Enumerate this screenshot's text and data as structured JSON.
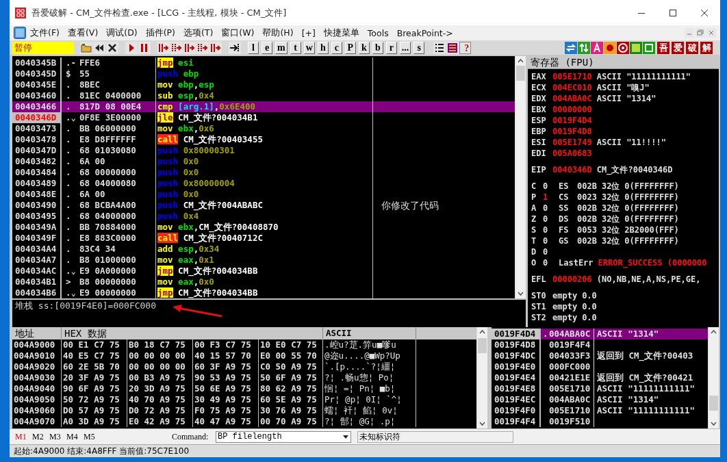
{
  "window": {
    "title": "吾爱破解 - CM_文件检查.exe - [LCG - 主线程, 模块 - CM_文件]"
  },
  "menu": [
    "文件(F)",
    "查看(V)",
    "调试(D)",
    "插件(P)",
    "选项(T)",
    "窗口(W)",
    "帮助(H)",
    "[+]",
    "快捷菜单",
    "Tools",
    "BreakPoint->"
  ],
  "toolbar": {
    "status": "暂停",
    "letter_buttons": [
      "l",
      "e",
      "m",
      "t",
      "w",
      "h",
      "c",
      "P",
      "k",
      "b",
      "r",
      "...",
      "s"
    ],
    "help_button": "?",
    "brand_buttons": [
      "吾",
      "爱",
      "破",
      "解"
    ]
  },
  "disassembly": {
    "rows": [
      {
        "address": "0040345B",
        "marker": ".-",
        "hex": "FFE6",
        "mnemonic": "jmp",
        "kind": "jump",
        "operands": [
          {
            "kind": "reg",
            "text": "esi"
          }
        ],
        "selected": false,
        "current": false
      },
      {
        "address": "0040345D",
        "marker": "$",
        "hex": "55",
        "mnemonic": "push",
        "kind": "push",
        "operands": [
          {
            "kind": "reg",
            "text": "ebp"
          }
        ],
        "selected": false,
        "current": false
      },
      {
        "address": "0040345E",
        "marker": ".",
        "hex": "8BEC",
        "mnemonic": "mov",
        "kind": "plain",
        "operands": [
          {
            "kind": "reg",
            "text": "ebp"
          },
          {
            "kind": "sep",
            "text": ","
          },
          {
            "kind": "reg",
            "text": "esp"
          }
        ],
        "selected": false,
        "current": false
      },
      {
        "address": "00403460",
        "marker": ".",
        "hex": "81EC 0400000",
        "mnemonic": "sub",
        "kind": "plain",
        "operands": [
          {
            "kind": "reg",
            "text": "esp"
          },
          {
            "kind": "sep",
            "text": ","
          },
          {
            "kind": "imm",
            "text": "0x4"
          }
        ],
        "selected": false,
        "current": false
      },
      {
        "address": "00403466",
        "marker": ".",
        "hex": "817D 08 00E4",
        "mnemonic": "cmp",
        "kind": "plain",
        "operands": [
          {
            "kind": "mem",
            "text": "[arg.1]"
          },
          {
            "kind": "sep",
            "text": ","
          },
          {
            "kind": "imm",
            "text": "0x6E400"
          }
        ],
        "selected": true,
        "current": false
      },
      {
        "address": "0040346D",
        "marker": ".⌄",
        "hex": "0F8E 3E00000",
        "mnemonic": "jle",
        "kind": "jump",
        "operands": [
          {
            "kind": "label",
            "text": "CM_文件?004034B1"
          }
        ],
        "selected": false,
        "current": true
      },
      {
        "address": "00403473",
        "marker": ".",
        "hex": "BB 06000000",
        "mnemonic": "mov",
        "kind": "plain",
        "operands": [
          {
            "kind": "reg",
            "text": "ebx"
          },
          {
            "kind": "sep",
            "text": ","
          },
          {
            "kind": "imm",
            "text": "0x6"
          }
        ],
        "selected": false,
        "current": false
      },
      {
        "address": "00403478",
        "marker": ".",
        "hex": "E8 D8FFFFFF",
        "mnemonic": "call",
        "kind": "call",
        "operands": [
          {
            "kind": "label",
            "text": "CM_文件?00403455"
          }
        ],
        "selected": false,
        "current": false
      },
      {
        "address": "0040347D",
        "marker": ".",
        "hex": "68 01030080",
        "mnemonic": "push",
        "kind": "push",
        "operands": [
          {
            "kind": "imm",
            "text": "0x80000301"
          }
        ],
        "selected": false,
        "current": false
      },
      {
        "address": "00403482",
        "marker": ".",
        "hex": "6A 00",
        "mnemonic": "push",
        "kind": "push",
        "operands": [
          {
            "kind": "imm",
            "text": "0x0"
          }
        ],
        "selected": false,
        "current": false
      },
      {
        "address": "00403484",
        "marker": ".",
        "hex": "68 00000000",
        "mnemonic": "push",
        "kind": "push",
        "operands": [
          {
            "kind": "imm",
            "text": "0x0"
          }
        ],
        "selected": false,
        "current": false
      },
      {
        "address": "00403489",
        "marker": ".",
        "hex": "68 04000080",
        "mnemonic": "push",
        "kind": "push",
        "operands": [
          {
            "kind": "imm",
            "text": "0x80000004"
          }
        ],
        "selected": false,
        "current": false
      },
      {
        "address": "0040348E",
        "marker": ".",
        "hex": "6A 00",
        "mnemonic": "push",
        "kind": "push",
        "operands": [
          {
            "kind": "imm",
            "text": "0x0"
          }
        ],
        "selected": false,
        "current": false
      },
      {
        "address": "00403490",
        "marker": ".",
        "hex": "68 BCBA4A00",
        "mnemonic": "push",
        "kind": "push",
        "operands": [
          {
            "kind": "label",
            "text": "CM_文件?004ABABC"
          }
        ],
        "comment": "你修改了代码",
        "selected": false,
        "current": false
      },
      {
        "address": "00403495",
        "marker": ".",
        "hex": "68 04000000",
        "mnemonic": "push",
        "kind": "push",
        "operands": [
          {
            "kind": "imm",
            "text": "0x4"
          }
        ],
        "selected": false,
        "current": false
      },
      {
        "address": "0040349A",
        "marker": ".",
        "hex": "BB 70884000",
        "mnemonic": "mov",
        "kind": "plain",
        "operands": [
          {
            "kind": "reg",
            "text": "ebx"
          },
          {
            "kind": "sep",
            "text": ","
          },
          {
            "kind": "label",
            "text": "CM_文件?00408870"
          }
        ],
        "selected": false,
        "current": false
      },
      {
        "address": "0040349F",
        "marker": ".",
        "hex": "E8 883C0000",
        "mnemonic": "call",
        "kind": "call",
        "operands": [
          {
            "kind": "label",
            "text": "CM_文件?0040712C"
          }
        ],
        "selected": false,
        "current": false
      },
      {
        "address": "004034A4",
        "marker": ".",
        "hex": "83C4 34",
        "mnemonic": "add",
        "kind": "plain",
        "operands": [
          {
            "kind": "reg",
            "text": "esp"
          },
          {
            "kind": "sep",
            "text": ","
          },
          {
            "kind": "imm",
            "text": "0x34"
          }
        ],
        "selected": false,
        "current": false
      },
      {
        "address": "004034A7",
        "marker": ".",
        "hex": "B8 01000000",
        "mnemonic": "mov",
        "kind": "plain",
        "operands": [
          {
            "kind": "reg",
            "text": "eax"
          },
          {
            "kind": "sep",
            "text": ","
          },
          {
            "kind": "imm",
            "text": "0x1"
          }
        ],
        "selected": false,
        "current": false
      },
      {
        "address": "004034AC",
        "marker": ".⌄",
        "hex": "E9 0A000000",
        "mnemonic": "jmp",
        "kind": "jump",
        "operands": [
          {
            "kind": "label",
            "text": "CM_文件?004034BB"
          }
        ],
        "selected": false,
        "current": false
      },
      {
        "address": "004034B1",
        "marker": ">",
        "hex": "B8 00000000",
        "mnemonic": "mov",
        "kind": "plain",
        "operands": [
          {
            "kind": "reg",
            "text": "eax"
          },
          {
            "kind": "sep",
            "text": ","
          },
          {
            "kind": "imm",
            "text": "0x0"
          }
        ],
        "selected": false,
        "current": false
      },
      {
        "address": "004034B6",
        "marker": ".⌄",
        "hex": "E9 00000000",
        "mnemonic": "jmp",
        "kind": "jump",
        "operands": [
          {
            "kind": "label",
            "text": "CM_文件?004034BB"
          }
        ],
        "selected": false,
        "current": false
      }
    ],
    "info": "堆栈 ss:[0019F4E0]=000FC000"
  },
  "registers": {
    "title": "寄存器 (FPU)",
    "general": [
      {
        "name": "EAX",
        "value": "005E1710",
        "comment": "ASCII \"11111111111\"",
        "changed": true
      },
      {
        "name": "ECX",
        "value": "004EC010",
        "comment": "ASCII \"嗅J\"",
        "changed": true
      },
      {
        "name": "EDX",
        "value": "004ABA0C",
        "comment": "ASCII \"1314\"",
        "changed": true
      },
      {
        "name": "EBX",
        "value": "00000000",
        "changed": true
      },
      {
        "name": "ESP",
        "value": "0019F4D4",
        "changed": true
      },
      {
        "name": "EBP",
        "value": "0019F4D8",
        "changed": true
      },
      {
        "name": "ESI",
        "value": "005E1749",
        "comment": "ASCII \"11!!!!\"",
        "changed": true
      },
      {
        "name": "EDI",
        "value": "005A0683",
        "changed": true
      }
    ],
    "eip": {
      "name": "EIP",
      "value": "0040346D",
      "comment": "CM_文件?0040346D",
      "changed": true
    },
    "flags": [
      {
        "flag": "C",
        "value": "0",
        "changed": false,
        "kind": "segment",
        "segment": "ES",
        "selector": "002B",
        "bits": "32位",
        "base": "0(FFFFFFFF)"
      },
      {
        "flag": "P",
        "value": "1",
        "changed": true,
        "kind": "segment",
        "segment": "CS",
        "selector": "0023",
        "bits": "32位",
        "base": "0(FFFFFFFF)"
      },
      {
        "flag": "A",
        "value": "0",
        "changed": false,
        "kind": "segment",
        "segment": "SS",
        "selector": "002B",
        "bits": "32位",
        "base": "0(FFFFFFFF)"
      },
      {
        "flag": "Z",
        "value": "0",
        "changed": false,
        "kind": "segment",
        "segment": "DS",
        "selector": "002B",
        "bits": "32位",
        "base": "0(FFFFFFFF)"
      },
      {
        "flag": "S",
        "value": "0",
        "changed": false,
        "kind": "segment",
        "segment": "FS",
        "selector": "0053",
        "bits": "32位",
        "base": "2B2000(FFF)"
      },
      {
        "flag": "T",
        "value": "0",
        "changed": false,
        "kind": "segment",
        "segment": "GS",
        "selector": "002B",
        "bits": "32位",
        "base": "0(FFFFFFFF)"
      },
      {
        "flag": "D",
        "value": "0",
        "changed": false,
        "kind": "none"
      },
      {
        "flag": "O",
        "value": "0",
        "changed": false,
        "kind": "lasterr",
        "label": "LastErr",
        "error": "ERROR_SUCCESS (0000000"
      }
    ],
    "efl": {
      "name": "EFL",
      "value": "00000206",
      "decoded": "(NO,NB,NE,A,NS,PE,GE,",
      "changed": true
    },
    "fpu": [
      {
        "name": "ST0",
        "tag": "empty",
        "value": "0.0"
      },
      {
        "name": "ST1",
        "tag": "empty",
        "value": "0.0"
      },
      {
        "name": "ST2",
        "tag": "empty",
        "value": "0.0"
      }
    ]
  },
  "dump": {
    "columns": [
      "地址",
      "HEX 数据",
      "ASCII"
    ],
    "rows": [
      {
        "address": "004A9000",
        "hex": [
          "00 E1 C7 75",
          "B0 18 C7 75",
          "00 F3 C7 75",
          "10 E0 C7 75"
        ],
        "ascii": ".崆u?莡.笄u■嗲u"
      },
      {
        "address": "004A9010",
        "hex": [
          "40 E5 C7 75",
          "00 00 00 00",
          "40 15 57 70",
          "E0 00 55 70"
        ],
        "ascii": "@迩u....@■Wp?Up"
      },
      {
        "address": "004A9020",
        "hex": [
          "60 2E 5B 70",
          "00 00 00 00",
          "60 3F A9 75",
          "C0 50 A9 75"
        ],
        "ascii": "`.[p....`?¦繮¦"
      },
      {
        "address": "004A9030",
        "hex": [
          "20 3F A9 75",
          "00 B3 A9 75",
          "90 53 A9 75",
          "50 6F A9 75"
        ],
        "ascii": "?¦ .畅u惣¦ Po¦"
      },
      {
        "address": "004A9040",
        "hex": [
          "90 6F A9 75",
          "20 3D A9 75",
          "50 6E A9 75",
          "80 62 A9 75"
        ],
        "ascii": "恛¦ =¦ Pn¦ ■b¦"
      },
      {
        "address": "004A9050",
        "hex": [
          "50 72 A9 75",
          "40 70 A9 75",
          "30 49 A9 75",
          "60 5E A9 75"
        ],
        "ascii": "Pr¦ @p¦ 0I¦ `^¦"
      },
      {
        "address": "004A9060",
        "hex": [
          "D0 57 A9 75",
          "D0 72 A9 75",
          "F0 75 A9 75",
          "30 76 A9 75"
        ],
        "ascii": "蠕¦ 衦¦ 餡¦ 0v¦"
      },
      {
        "address": "004A9070",
        "hex": [
          "A0 3D A9 75",
          "E0 42 A9 75",
          "40 47 A9 75",
          "00 70 A9 75"
        ],
        "ascii": "?¦ 郜¦ @G¦ .p¦"
      }
    ]
  },
  "stack": {
    "rows": [
      {
        "address": "0019F4D4",
        "marker": ".",
        "value": "004ABA0C",
        "comment": "ASCII \"1314\"",
        "selected": true
      },
      {
        "address": "0019F4D8",
        "value": "0019F4F4",
        "selected": false
      },
      {
        "address": "0019F4DC",
        "value": "004033F3",
        "comment": "返回到 CM_文件?00403",
        "selected": false
      },
      {
        "address": "0019F4E0",
        "value": "000FC000",
        "selected": false
      },
      {
        "address": "0019F4E4",
        "value": "00421E1E",
        "comment": "返回到 CM_文件?00421",
        "selected": false
      },
      {
        "address": "0019F4E8",
        "value": "005E1710",
        "comment": "ASCII \"11111111111\"",
        "selected": false
      },
      {
        "address": "0019F4EC",
        "value": "004ABA0C",
        "comment": "ASCII \"1314\"",
        "selected": false
      },
      {
        "address": "0019F4F0",
        "value": "005E1710",
        "comment": "ASCII \"11111111111\"",
        "selected": false
      },
      {
        "address": "0019F4F4",
        "value": "0019F510",
        "selected": false
      }
    ]
  },
  "command_bar": {
    "memory_buttons": [
      {
        "label": "M1",
        "selected": true
      },
      {
        "label": "M2",
        "selected": false
      },
      {
        "label": "M3",
        "selected": false
      },
      {
        "label": "M4",
        "selected": false
      },
      {
        "label": "M5",
        "selected": false
      }
    ],
    "label": "Command:",
    "value": "BP filelength",
    "message": "未知标识符"
  },
  "status_bar": "起始:4A9000 结束:4A8FFF 当前值:75C7E100"
}
